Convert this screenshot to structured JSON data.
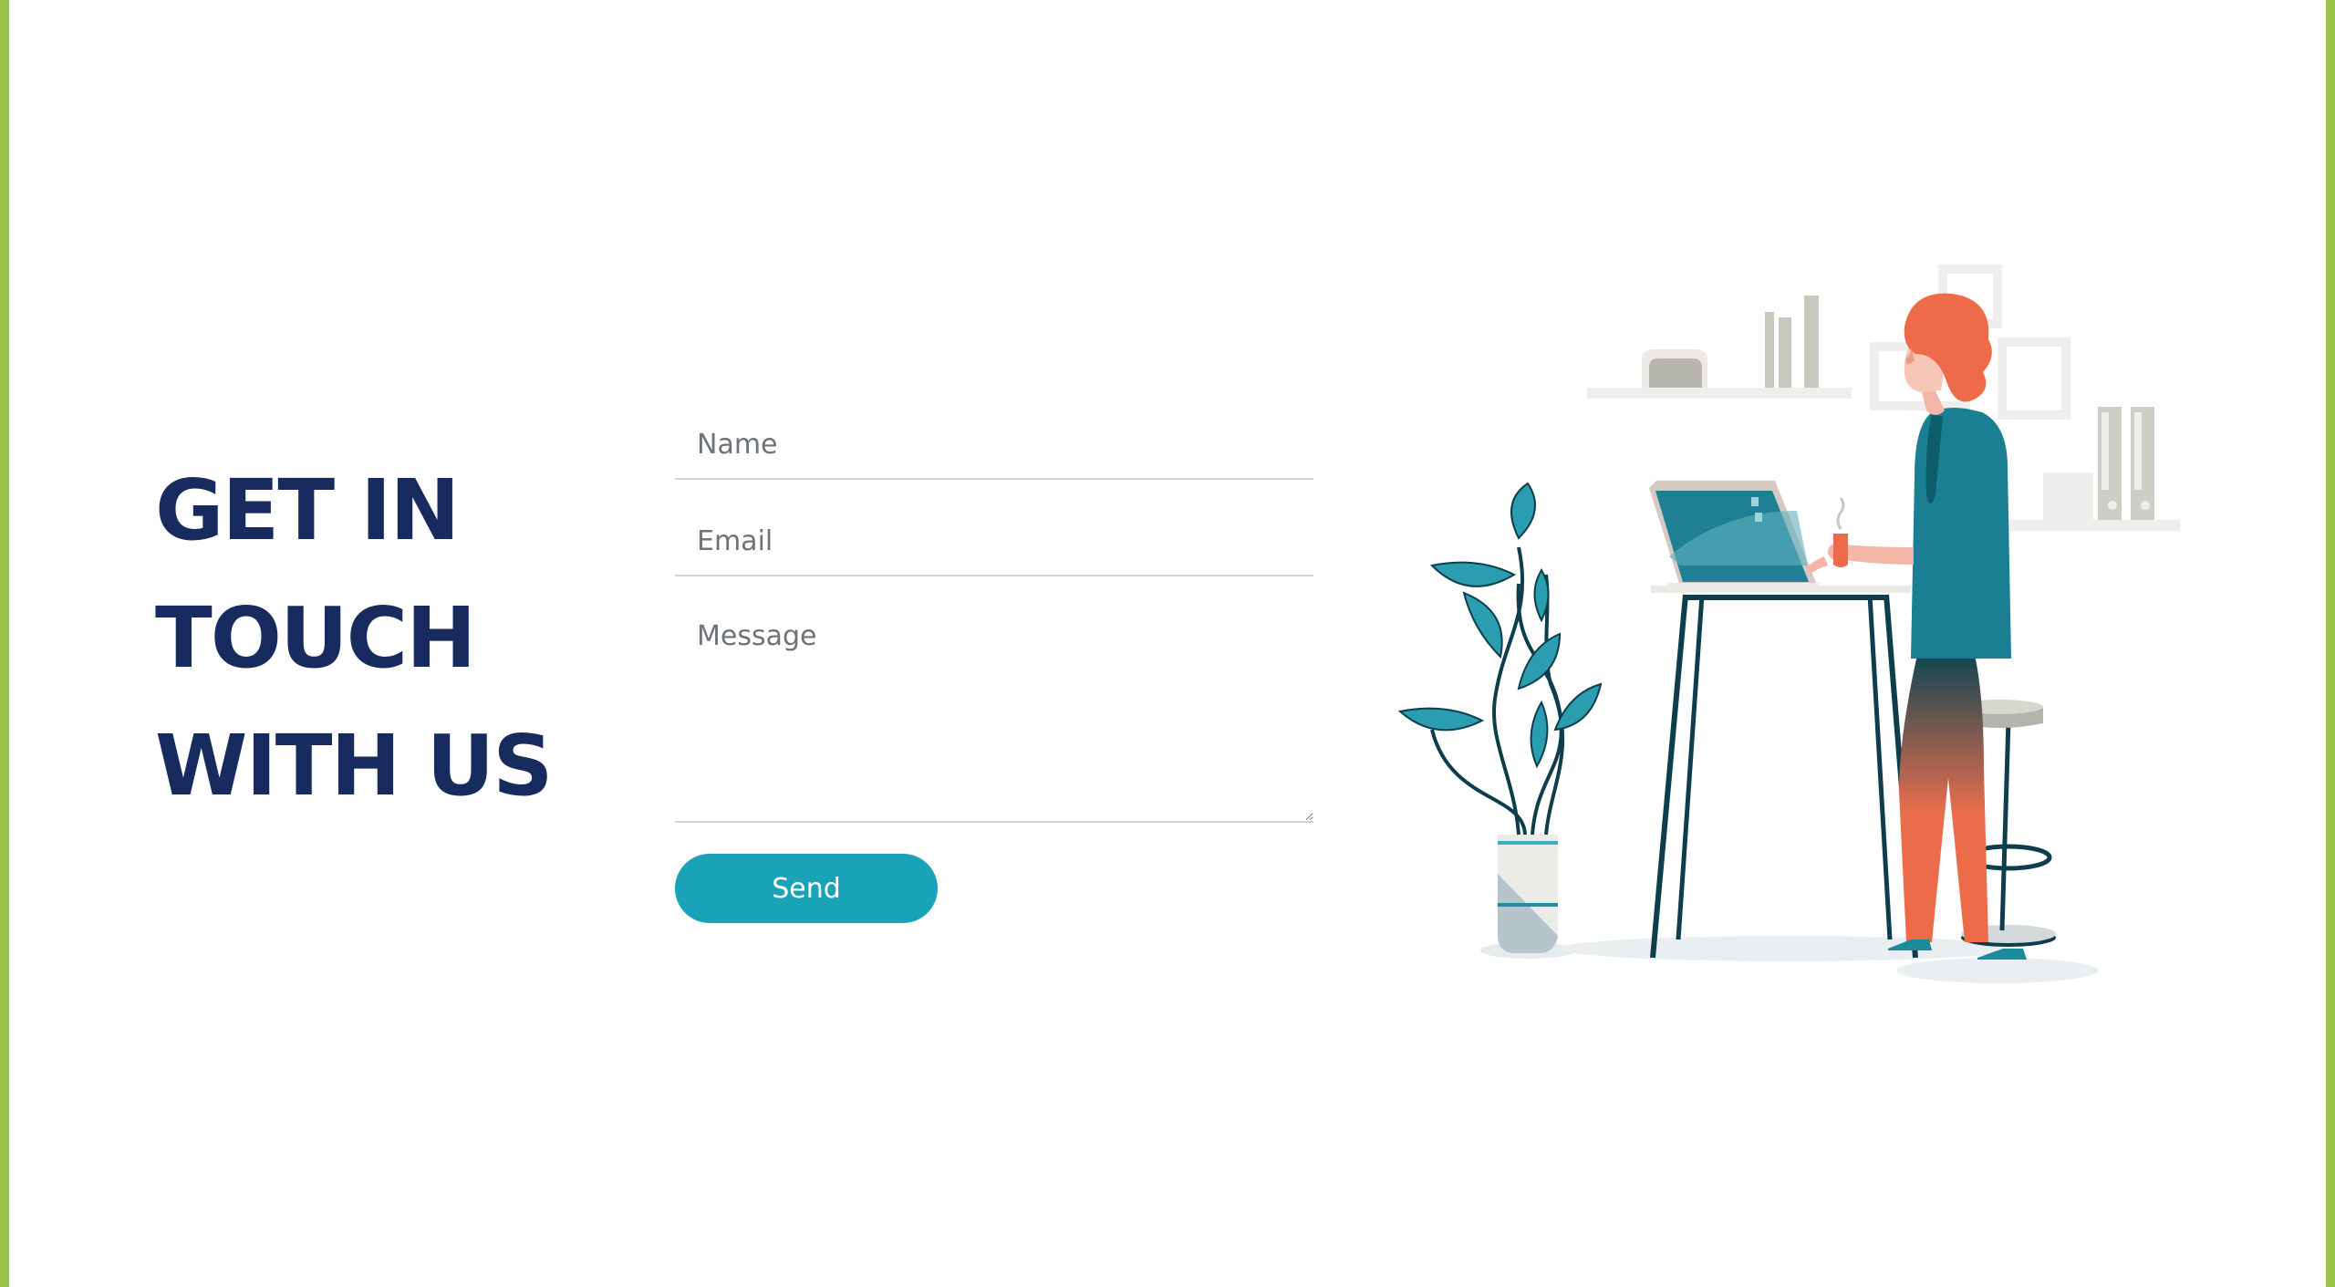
{
  "heading": {
    "line1": "GET IN",
    "line2": "TOUCH",
    "line3": "WITH US"
  },
  "form": {
    "name_placeholder": "Name",
    "email_placeholder": "Email",
    "message_placeholder": "Message",
    "send_label": "Send"
  },
  "colors": {
    "frame": "#9bc24a",
    "heading": "#172b5e",
    "accent": "#1aa3b8"
  },
  "illustration": {
    "icon": "person-working-at-laptop-illustration"
  }
}
